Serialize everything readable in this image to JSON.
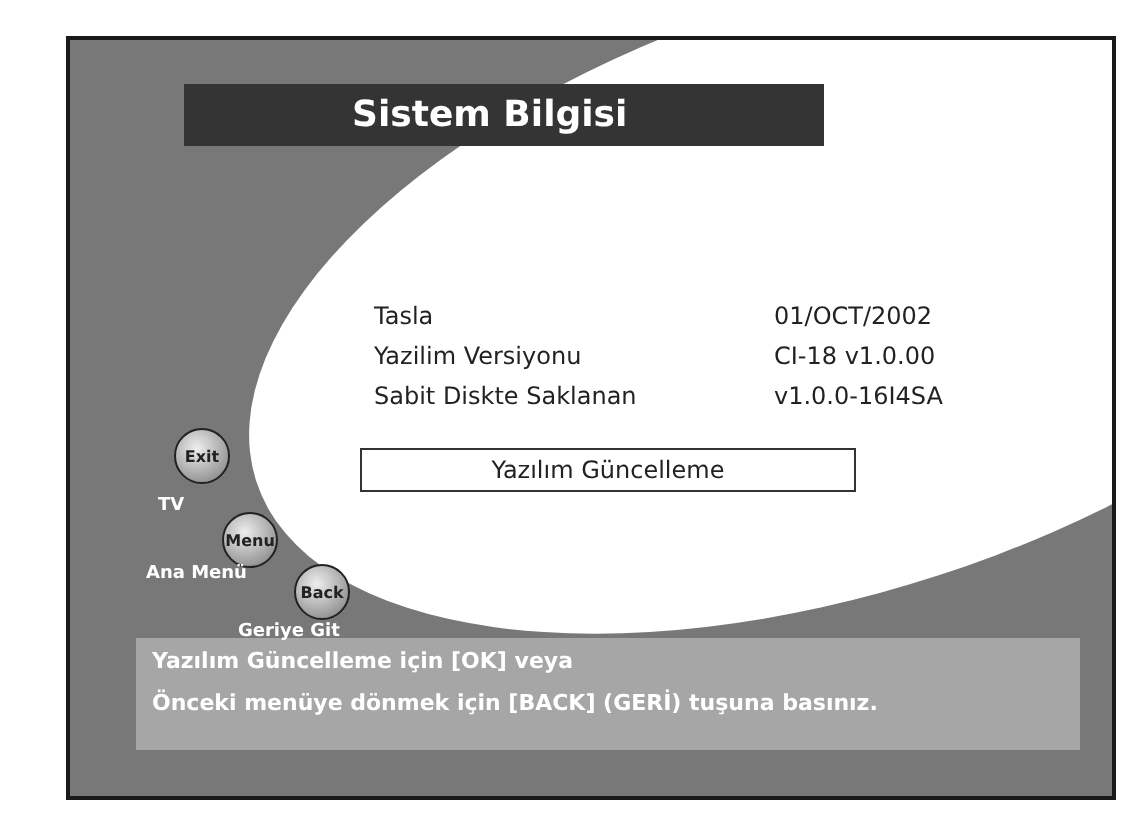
{
  "title": "Sistem Bilgisi",
  "info_rows": [
    {
      "label": "Tasla",
      "value": "01/OCT/2002"
    },
    {
      "label": "Yazilim Versiyonu",
      "value": "CI-18 v1.0.00"
    },
    {
      "label": "Sabit Diskte Saklanan",
      "value": "v1.0.0-16I4SA"
    }
  ],
  "action_button": {
    "label": "Yazılım Güncelleme"
  },
  "keys": [
    {
      "key": "Exit",
      "label": "TV"
    },
    {
      "key": "Menu",
      "label": "Ana Menü"
    },
    {
      "key": "Back",
      "label": "Geriye Git"
    }
  ],
  "help_lines": [
    "Yazılım Güncelleme için [OK] veya",
    "Önceki menüye dönmek için [BACK] (GERİ) tuşuna basınız."
  ]
}
